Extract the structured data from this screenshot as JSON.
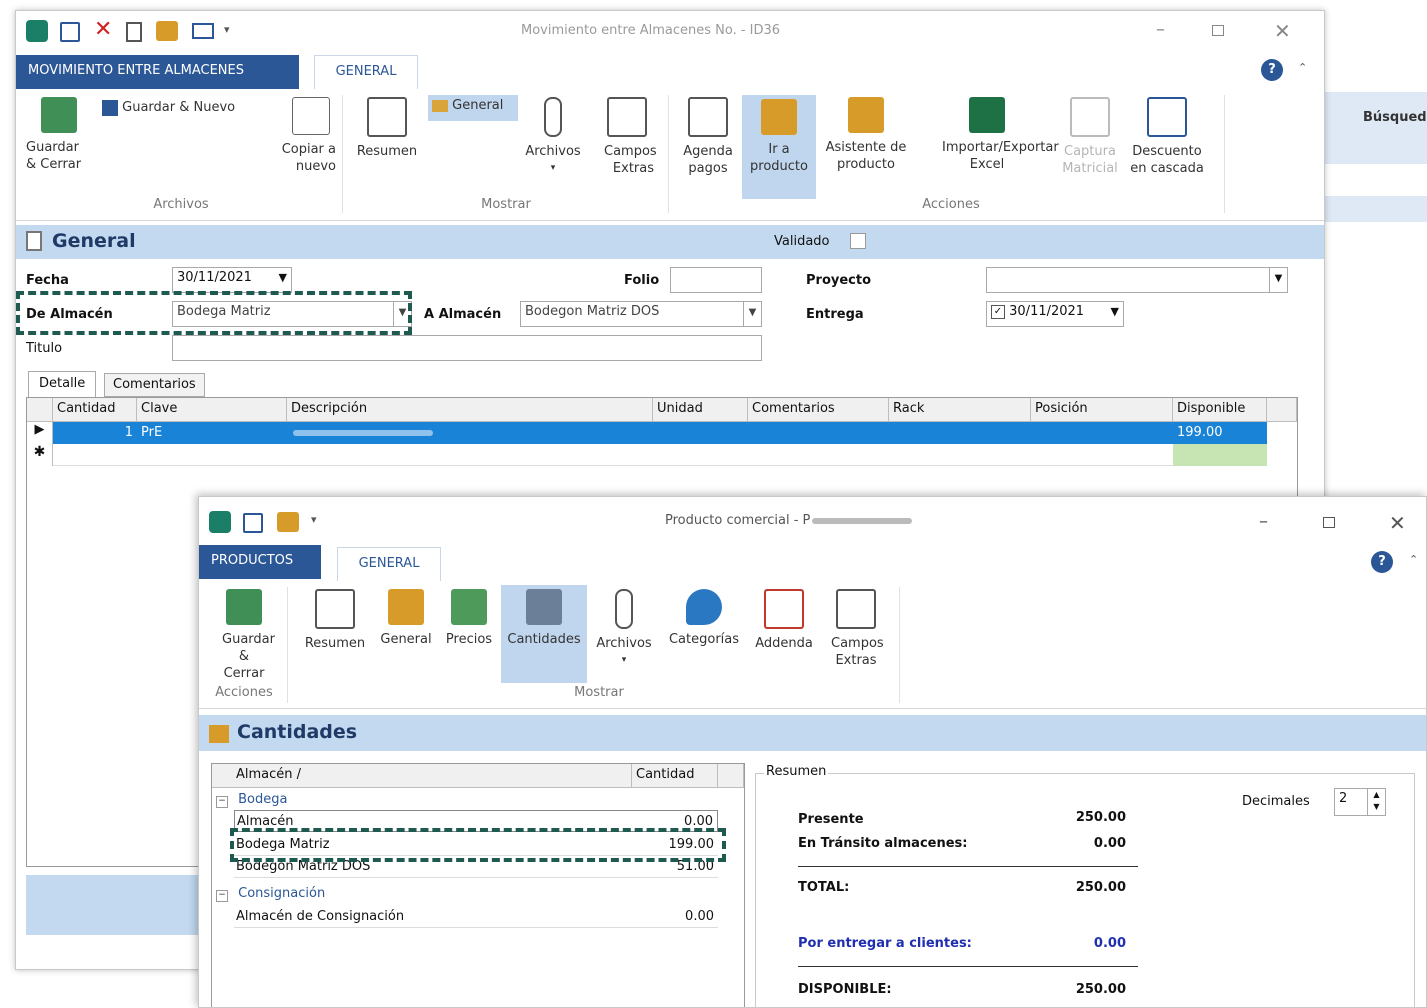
{
  "back_window": {
    "title": "Movimiento entre Almacenes No. - ID36",
    "tab_main": "MOVIMIENTO ENTRE ALMACENES",
    "tab_general": "GENERAL",
    "ribbon": {
      "guardar_cerrar": "Guardar & Cerrar",
      "guardar_nuevo": "Guardar & Nuevo",
      "copiar_nuevo": "Copiar a nuevo",
      "resumen": "Resumen",
      "general": "General",
      "archivos": "Archivos",
      "campos_extras": "Campos Extras",
      "agenda_pagos": "Agenda pagos",
      "ir_producto": "Ir a producto",
      "asistente_producto": "Asistente de producto",
      "importar_exportar": "Importar/Exportar Excel",
      "captura_matricial": "Captura Matricial",
      "descuento_cascada": "Descuento en cascada",
      "group_archivos": "Archivos",
      "group_mostrar": "Mostrar",
      "group_acciones": "Acciones"
    },
    "section_title": "General",
    "validado_label": "Validado",
    "form": {
      "fecha_label": "Fecha",
      "fecha_value": "30/11/2021",
      "folio_label": "Folio",
      "folio_value": "",
      "proyecto_label": "Proyecto",
      "proyecto_value": "",
      "de_almacen_label": "De Almacén",
      "de_almacen_value": "Bodega Matriz",
      "a_almacen_label": "A Almacén",
      "a_almacen_value": "Bodegon Matriz DOS",
      "entrega_label": "Entrega",
      "entrega_value": "30/11/2021",
      "titulo_label": "Titulo",
      "titulo_value": ""
    },
    "subtabs": [
      "Detalle",
      "Comentarios"
    ],
    "grid": {
      "headers": [
        "Cantidad",
        "Clave",
        "Descripción",
        "Unidad",
        "Comentarios",
        "Rack",
        "Posición",
        "Disponible"
      ],
      "rows": [
        {
          "cantidad": "1",
          "clave": "PrE",
          "descripcion": "",
          "unidad": "",
          "comentarios": "",
          "rack": "",
          "posicion": "",
          "disponible": "199.00"
        }
      ]
    },
    "side_panel": {
      "busqueda": "Búsqued"
    }
  },
  "front_window": {
    "title": "Producto comercial - P",
    "tab_main": "PRODUCTOS",
    "tab_general": "GENERAL",
    "ribbon": {
      "guardar_cerrar": "Guardar & Cerrar",
      "resumen": "Resumen",
      "general": "General",
      "precios": "Precios",
      "cantidades": "Cantidades",
      "archivos": "Archivos",
      "categorias": "Categorías",
      "addenda": "Addenda",
      "campos_extras": "Campos Extras",
      "group_acciones": "Acciones",
      "group_mostrar": "Mostrar"
    },
    "section_title": "Cantidades",
    "tree": {
      "col_almacen": "Almacén /",
      "col_cantidad": "Cantidad",
      "groups": [
        {
          "name": "Bodega",
          "items": [
            {
              "name": "Almacén",
              "qty": "0.00"
            },
            {
              "name": "Bodega Matriz",
              "qty": "199.00"
            },
            {
              "name": "Bodegon Matriz DOS",
              "qty": "51.00"
            }
          ]
        },
        {
          "name": "Consignación",
          "items": [
            {
              "name": "Almacén de Consignación",
              "qty": "0.00"
            }
          ]
        }
      ]
    },
    "resumen": {
      "legend": "Resumen",
      "decimales_label": "Decimales",
      "decimales_value": "2",
      "presente_label": "Presente",
      "presente_value": "250.00",
      "transito_label": "En Tránsito almacenes:",
      "transito_value": "0.00",
      "total_label": "TOTAL:",
      "total_value": "250.00",
      "por_entregar_label": "Por entregar a clientes:",
      "por_entregar_value": "0.00",
      "disponible_label": "DISPONIBLE:",
      "disponible_value": "250.00"
    }
  },
  "colors": {
    "accent": "#2b5797",
    "header_band": "#c3d9f0",
    "selection": "#1883d7",
    "dashed_highlight": "#1e5a50"
  }
}
